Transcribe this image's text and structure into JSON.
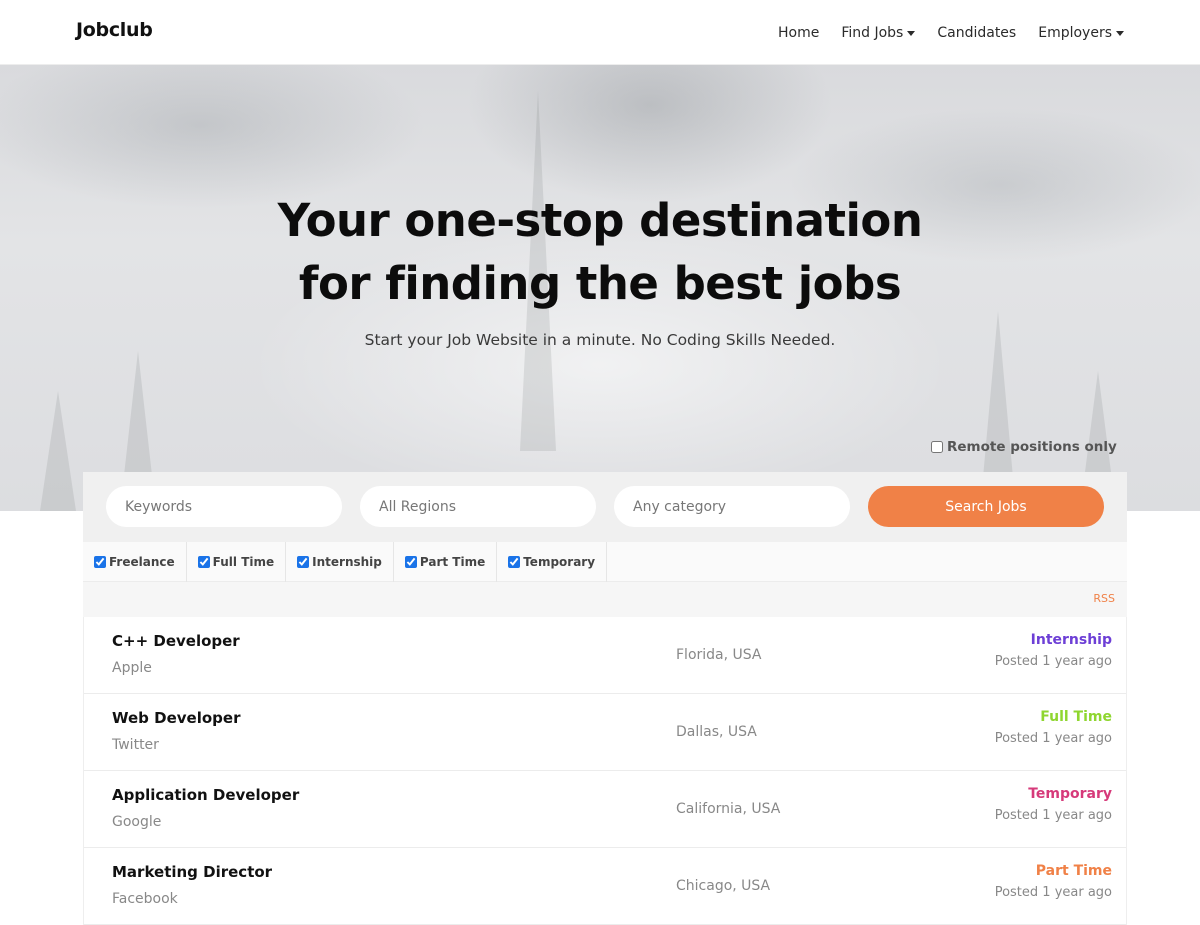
{
  "navbar": {
    "logo": "Jobclub",
    "links": [
      {
        "label": "Home"
      },
      {
        "label": "Find Jobs"
      },
      {
        "label": "Candidates"
      },
      {
        "label": "Employers"
      }
    ]
  },
  "hero": {
    "title_line1": "Your one-stop destination",
    "title_line2": "for finding the best jobs",
    "subtitle": "Start your Job Website in a minute. No Coding Skills Needed."
  },
  "search": {
    "remote_label": "Remote positions only",
    "keywords_placeholder": "Keywords",
    "regions_placeholder": "All Regions",
    "category_placeholder": "Any category",
    "button_label": "Search Jobs"
  },
  "job_types": [
    {
      "label": "Freelance",
      "checked": true
    },
    {
      "label": "Full Time",
      "checked": true
    },
    {
      "label": "Internship",
      "checked": true
    },
    {
      "label": "Part Time",
      "checked": true
    },
    {
      "label": "Temporary",
      "checked": true
    }
  ],
  "rss_label": "RSS",
  "jobs": [
    {
      "title": "C++ Developer",
      "company": "Apple",
      "location": "Florida, USA",
      "type": "Internship",
      "type_color": "#6d3fd6",
      "posted": "Posted 1 year ago"
    },
    {
      "title": "Web Developer",
      "company": "Twitter",
      "location": "Dallas, USA",
      "type": "Full Time",
      "type_color": "#8fd630",
      "posted": "Posted 1 year ago"
    },
    {
      "title": "Application Developer",
      "company": "Google",
      "location": "California, USA",
      "type": "Temporary",
      "type_color": "#d63a7a",
      "posted": "Posted 1 year ago"
    },
    {
      "title": "Marketing Director",
      "company": "Facebook",
      "location": "Chicago, USA",
      "type": "Part Time",
      "type_color": "#f08147",
      "posted": "Posted 1 year ago"
    }
  ],
  "colors": {
    "accent": "#f08147"
  }
}
